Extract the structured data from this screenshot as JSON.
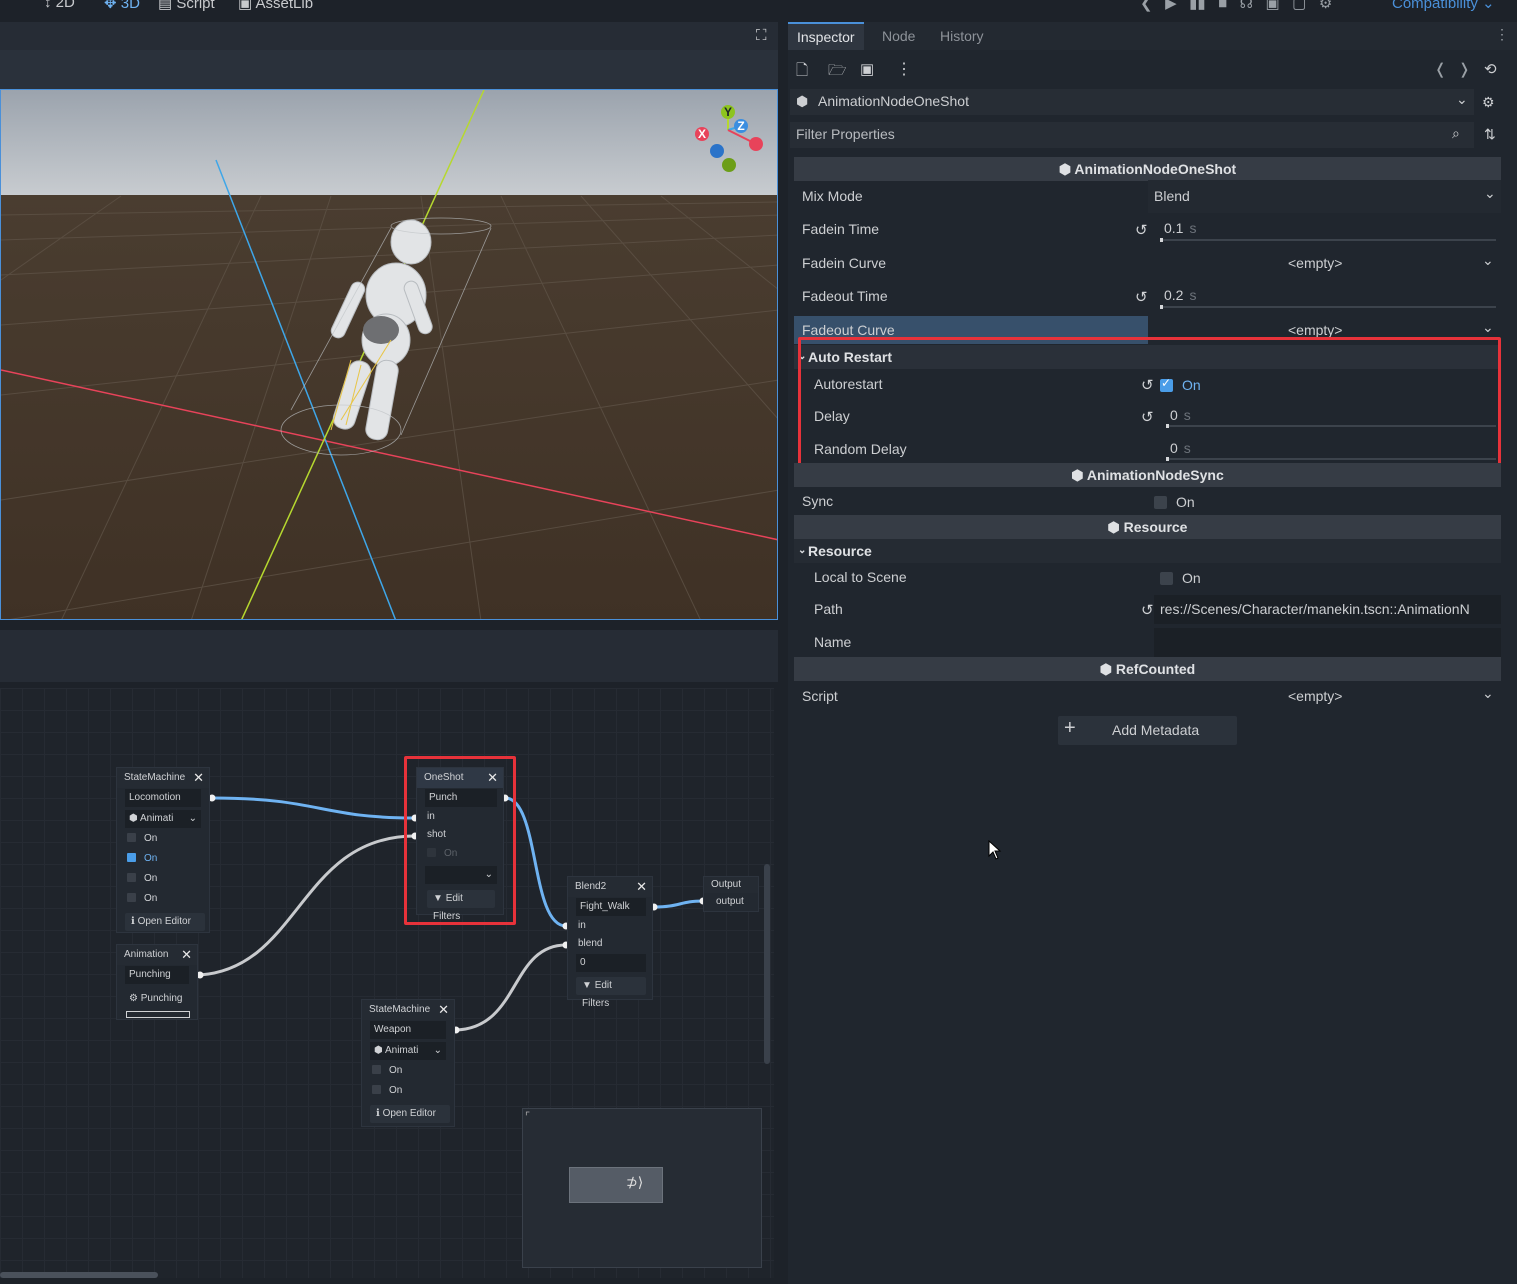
{
  "topbar": {
    "btn_2d": "2D",
    "btn_3d": "3D",
    "btn_script": "Script",
    "btn_assetlib": "AssetLib",
    "renderer": "Compatibility"
  },
  "graph": {
    "node_statemachine1": {
      "title": "StateMachine",
      "name": "Locomotion",
      "anim": "Animati",
      "checks": [
        "On",
        "On",
        "On",
        "On"
      ],
      "editor": "Open Editor"
    },
    "node_animation": {
      "title": "Animation",
      "name": "Punching",
      "anim": "Punching"
    },
    "node_oneshot": {
      "title": "OneShot",
      "name": "Punch",
      "port_in": "in",
      "port_shot": "shot",
      "check": "On",
      "filters": "Edit Filters"
    },
    "node_blend2": {
      "title": "Blend2",
      "name": "Fight_Walk",
      "port_in": "in",
      "port_blend": "blend",
      "value": "0",
      "filters": "Edit Filters"
    },
    "node_output": {
      "title": "Output",
      "port": "output"
    },
    "node_statemachine2": {
      "title": "StateMachine",
      "name": "Weapon",
      "anim": "Animati",
      "checks": [
        "On",
        "On"
      ],
      "editor": "Open Editor"
    }
  },
  "inspector": {
    "tabs": [
      "Inspector",
      "Node",
      "History"
    ],
    "resource_type": "AnimationNodeOneShot",
    "filter_placeholder": "Filter Properties",
    "sections": {
      "oneshot": "AnimationNodeOneShot",
      "sync": "AnimationNodeSync",
      "resource": "Resource",
      "refcounted": "RefCounted"
    },
    "props": {
      "mix_mode": {
        "label": "Mix Mode",
        "value": "Blend"
      },
      "fadein_time": {
        "label": "Fadein Time",
        "value": "0.1",
        "unit": "s"
      },
      "fadein_curve": {
        "label": "Fadein Curve",
        "value": "<empty>"
      },
      "fadeout_time": {
        "label": "Fadeout Time",
        "value": "0.2",
        "unit": "s"
      },
      "fadeout_curve": {
        "label": "Fadeout Curve",
        "value": "<empty>"
      },
      "auto_restart_group": "Auto Restart",
      "autorestart": {
        "label": "Autorestart",
        "value": "On"
      },
      "delay": {
        "label": "Delay",
        "value": "0",
        "unit": "s"
      },
      "random_delay": {
        "label": "Random Delay",
        "value": "0",
        "unit": "s"
      },
      "sync": {
        "label": "Sync",
        "value": "On"
      },
      "resource_group": "Resource",
      "local_to_scene": {
        "label": "Local to Scene",
        "value": "On"
      },
      "path": {
        "label": "Path",
        "value": "res://Scenes/Character/manekin.tscn::AnimationN"
      },
      "name": {
        "label": "Name",
        "value": ""
      },
      "script": {
        "label": "Script",
        "value": "<empty>"
      }
    },
    "add_metadata": "Add Metadata"
  },
  "colors": {
    "accent": "#4a90d9",
    "highlight": "#e7323a",
    "wire_blue": "#6fb3f2",
    "checkbox_on": "#4a9de8"
  }
}
